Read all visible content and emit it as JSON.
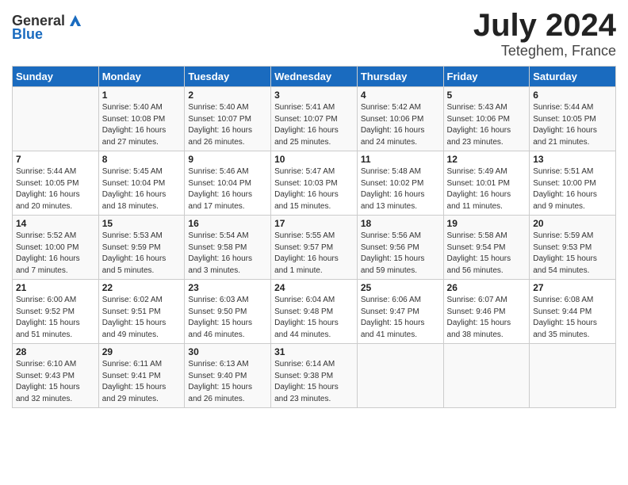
{
  "header": {
    "logo_general": "General",
    "logo_blue": "Blue",
    "month": "July 2024",
    "location": "Teteghem, France"
  },
  "weekdays": [
    "Sunday",
    "Monday",
    "Tuesday",
    "Wednesday",
    "Thursday",
    "Friday",
    "Saturday"
  ],
  "weeks": [
    [
      {
        "day": "",
        "info": ""
      },
      {
        "day": "1",
        "info": "Sunrise: 5:40 AM\nSunset: 10:08 PM\nDaylight: 16 hours\nand 27 minutes."
      },
      {
        "day": "2",
        "info": "Sunrise: 5:40 AM\nSunset: 10:07 PM\nDaylight: 16 hours\nand 26 minutes."
      },
      {
        "day": "3",
        "info": "Sunrise: 5:41 AM\nSunset: 10:07 PM\nDaylight: 16 hours\nand 25 minutes."
      },
      {
        "day": "4",
        "info": "Sunrise: 5:42 AM\nSunset: 10:06 PM\nDaylight: 16 hours\nand 24 minutes."
      },
      {
        "day": "5",
        "info": "Sunrise: 5:43 AM\nSunset: 10:06 PM\nDaylight: 16 hours\nand 23 minutes."
      },
      {
        "day": "6",
        "info": "Sunrise: 5:44 AM\nSunset: 10:05 PM\nDaylight: 16 hours\nand 21 minutes."
      }
    ],
    [
      {
        "day": "7",
        "info": "Sunrise: 5:44 AM\nSunset: 10:05 PM\nDaylight: 16 hours\nand 20 minutes."
      },
      {
        "day": "8",
        "info": "Sunrise: 5:45 AM\nSunset: 10:04 PM\nDaylight: 16 hours\nand 18 minutes."
      },
      {
        "day": "9",
        "info": "Sunrise: 5:46 AM\nSunset: 10:04 PM\nDaylight: 16 hours\nand 17 minutes."
      },
      {
        "day": "10",
        "info": "Sunrise: 5:47 AM\nSunset: 10:03 PM\nDaylight: 16 hours\nand 15 minutes."
      },
      {
        "day": "11",
        "info": "Sunrise: 5:48 AM\nSunset: 10:02 PM\nDaylight: 16 hours\nand 13 minutes."
      },
      {
        "day": "12",
        "info": "Sunrise: 5:49 AM\nSunset: 10:01 PM\nDaylight: 16 hours\nand 11 minutes."
      },
      {
        "day": "13",
        "info": "Sunrise: 5:51 AM\nSunset: 10:00 PM\nDaylight: 16 hours\nand 9 minutes."
      }
    ],
    [
      {
        "day": "14",
        "info": "Sunrise: 5:52 AM\nSunset: 10:00 PM\nDaylight: 16 hours\nand 7 minutes."
      },
      {
        "day": "15",
        "info": "Sunrise: 5:53 AM\nSunset: 9:59 PM\nDaylight: 16 hours\nand 5 minutes."
      },
      {
        "day": "16",
        "info": "Sunrise: 5:54 AM\nSunset: 9:58 PM\nDaylight: 16 hours\nand 3 minutes."
      },
      {
        "day": "17",
        "info": "Sunrise: 5:55 AM\nSunset: 9:57 PM\nDaylight: 16 hours\nand 1 minute."
      },
      {
        "day": "18",
        "info": "Sunrise: 5:56 AM\nSunset: 9:56 PM\nDaylight: 15 hours\nand 59 minutes."
      },
      {
        "day": "19",
        "info": "Sunrise: 5:58 AM\nSunset: 9:54 PM\nDaylight: 15 hours\nand 56 minutes."
      },
      {
        "day": "20",
        "info": "Sunrise: 5:59 AM\nSunset: 9:53 PM\nDaylight: 15 hours\nand 54 minutes."
      }
    ],
    [
      {
        "day": "21",
        "info": "Sunrise: 6:00 AM\nSunset: 9:52 PM\nDaylight: 15 hours\nand 51 minutes."
      },
      {
        "day": "22",
        "info": "Sunrise: 6:02 AM\nSunset: 9:51 PM\nDaylight: 15 hours\nand 49 minutes."
      },
      {
        "day": "23",
        "info": "Sunrise: 6:03 AM\nSunset: 9:50 PM\nDaylight: 15 hours\nand 46 minutes."
      },
      {
        "day": "24",
        "info": "Sunrise: 6:04 AM\nSunset: 9:48 PM\nDaylight: 15 hours\nand 44 minutes."
      },
      {
        "day": "25",
        "info": "Sunrise: 6:06 AM\nSunset: 9:47 PM\nDaylight: 15 hours\nand 41 minutes."
      },
      {
        "day": "26",
        "info": "Sunrise: 6:07 AM\nSunset: 9:46 PM\nDaylight: 15 hours\nand 38 minutes."
      },
      {
        "day": "27",
        "info": "Sunrise: 6:08 AM\nSunset: 9:44 PM\nDaylight: 15 hours\nand 35 minutes."
      }
    ],
    [
      {
        "day": "28",
        "info": "Sunrise: 6:10 AM\nSunset: 9:43 PM\nDaylight: 15 hours\nand 32 minutes."
      },
      {
        "day": "29",
        "info": "Sunrise: 6:11 AM\nSunset: 9:41 PM\nDaylight: 15 hours\nand 29 minutes."
      },
      {
        "day": "30",
        "info": "Sunrise: 6:13 AM\nSunset: 9:40 PM\nDaylight: 15 hours\nand 26 minutes."
      },
      {
        "day": "31",
        "info": "Sunrise: 6:14 AM\nSunset: 9:38 PM\nDaylight: 15 hours\nand 23 minutes."
      },
      {
        "day": "",
        "info": ""
      },
      {
        "day": "",
        "info": ""
      },
      {
        "day": "",
        "info": ""
      }
    ]
  ]
}
